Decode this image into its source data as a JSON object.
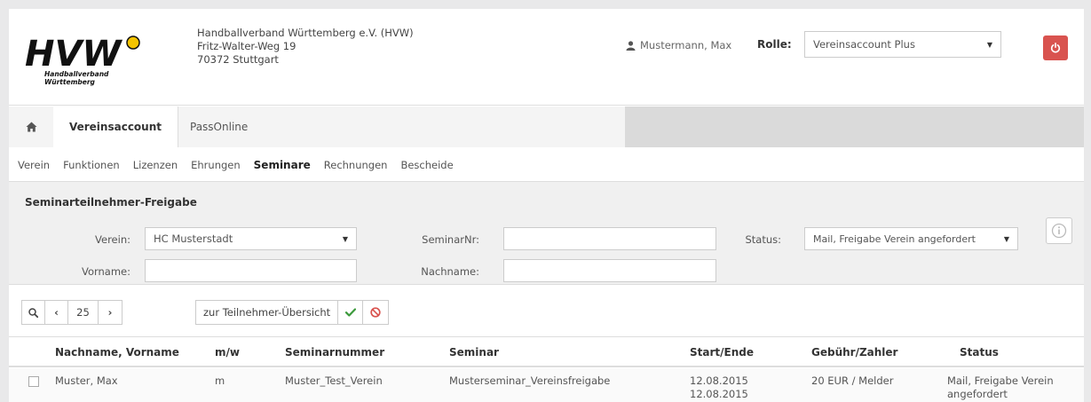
{
  "header": {
    "org_name": "Handballverband Württemberg e.V. (HVW)",
    "street": "Fritz-Walter-Weg 19",
    "city": "70372 Stuttgart",
    "logo_text": "HVW",
    "logo_sub1": "Handballverband",
    "logo_sub2": "Württemberg",
    "user_name": "Mustermann, Max",
    "role_label": "Rolle:",
    "role_value": "Vereinsaccount Plus"
  },
  "tabs": [
    {
      "label": "Vereinsaccount"
    },
    {
      "label": "PassOnline"
    }
  ],
  "subnav": [
    "Verein",
    "Funktionen",
    "Lizenzen",
    "Ehrungen",
    "Seminare",
    "Rechnungen",
    "Bescheide"
  ],
  "filter": {
    "title": "Seminarteilnehmer-Freigabe",
    "verein_label": "Verein:",
    "verein_value": "HC Musterstadt",
    "vorname_label": "Vorname:",
    "seminarnr_label": "SeminarNr:",
    "nachname_label": "Nachname:",
    "status_label": "Status:",
    "status_value": "Mail, Freigabe Verein angefordert"
  },
  "toolbar": {
    "page_size": "25",
    "overview_label": "zur Teilnehmer-Übersicht"
  },
  "table": {
    "columns": [
      "Nachname, Vorname",
      "m/w",
      "Seminarnummer",
      "Seminar",
      "Start/Ende",
      "Gebühr/Zahler",
      "Status"
    ],
    "rows": [
      {
        "name": "Muster, Max",
        "gender": "m",
        "seminar_nr": "Muster_Test_Verein",
        "seminar": "Musterseminar_Vereinsfreigabe",
        "start": "12.08.2015",
        "end": "12.08.2015",
        "fee": "20 EUR / Melder",
        "status_line1": "Mail, Freigabe Verein",
        "status_line2": "angefordert"
      }
    ]
  },
  "colors": {
    "accent_red": "#d9534f",
    "logo_yellow": "#f5c400",
    "check_green": "#3c9a3c",
    "panel_bg": "#f0f0f0"
  }
}
